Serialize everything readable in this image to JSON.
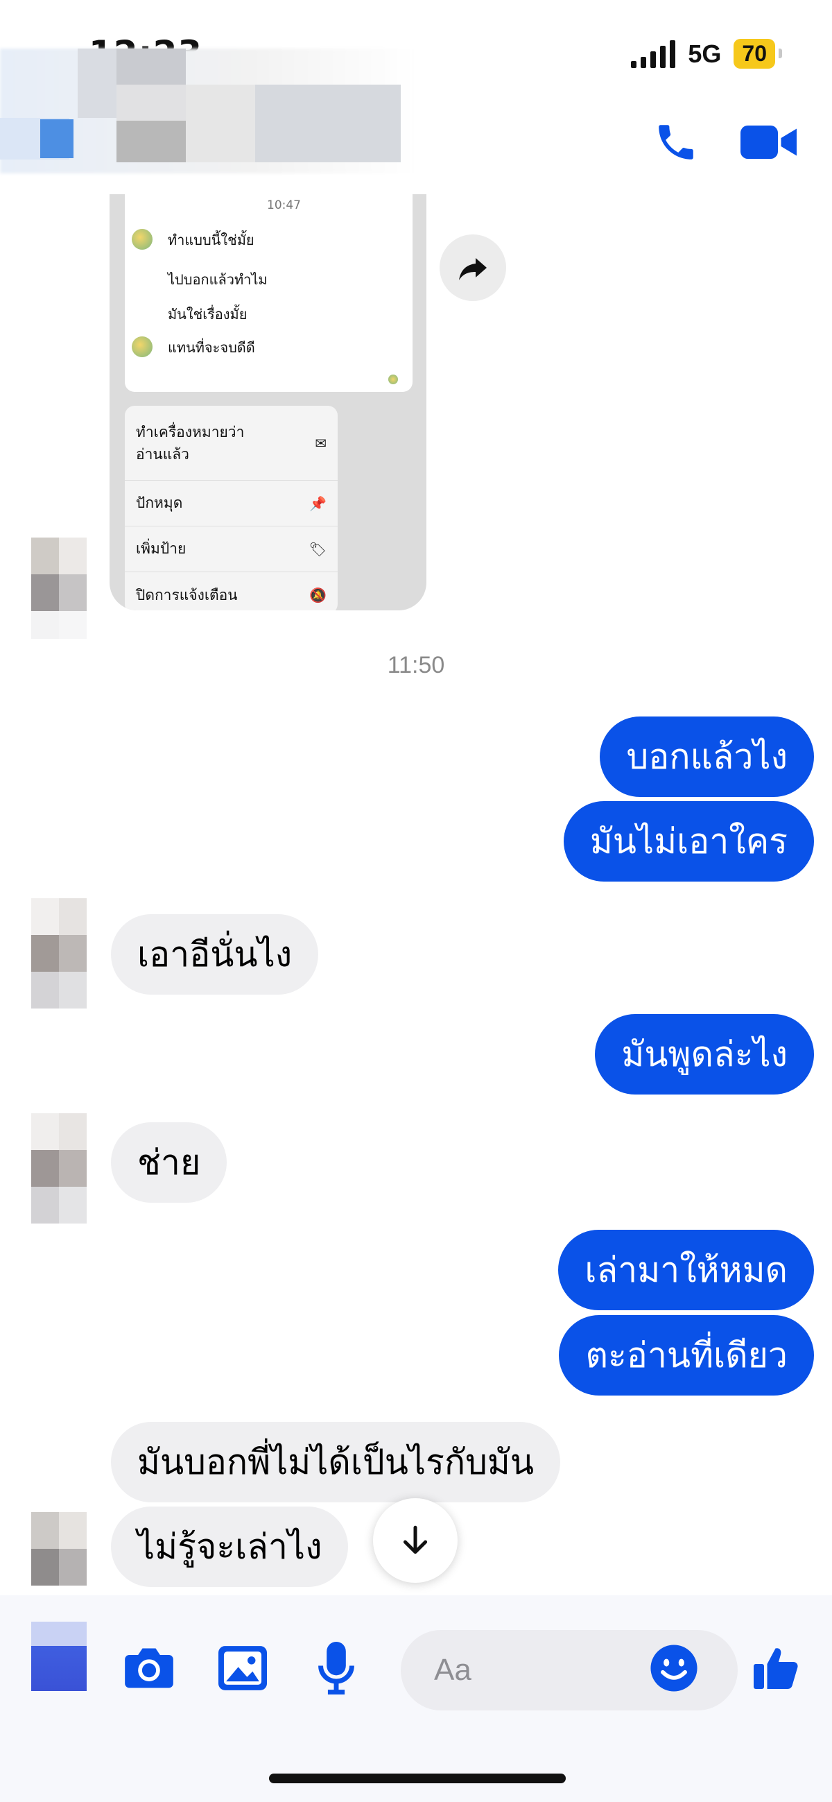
{
  "status_bar": {
    "time": "12:23",
    "network": "5G",
    "battery": "70"
  },
  "header": {
    "contact_name": "",
    "call_icon": "phone-icon",
    "video_icon": "video-camera-icon"
  },
  "forwarded_screenshot": {
    "time": "10:47",
    "messages": [
      "ทำแบบนี้ใช่มั้ย",
      "ไปบอกแล้วทำไม",
      "มันใช่เรื่องมั้ย",
      "แทนที่จะจบดีดี"
    ],
    "menu": [
      {
        "label_line1": "ทำเครื่องหมายว่า",
        "label_line2": "อ่านแล้ว",
        "icon": "mark-read-icon"
      },
      {
        "label_line1": "ปักหมุด",
        "label_line2": "",
        "icon": "pin-icon"
      },
      {
        "label_line1": "เพิ่มป้าย",
        "label_line2": "",
        "icon": "tag-icon"
      },
      {
        "label_line1": "ปิดการแจ้งเตือน",
        "label_line2": "",
        "icon": "mute-icon"
      }
    ]
  },
  "conversation": {
    "timestamp": "11:50",
    "messages": [
      {
        "side": "out",
        "text": "บอกแล้วไง"
      },
      {
        "side": "out",
        "text": "มันไม่เอาใคร"
      },
      {
        "side": "in",
        "text": "เอาอีนั่นไง"
      },
      {
        "side": "out",
        "text": "มันพูดล่ะไง"
      },
      {
        "side": "in",
        "text": "ช่าย"
      },
      {
        "side": "out",
        "text": "เล่ามาให้หมด"
      },
      {
        "side": "out",
        "text": "ตะอ่านที่เดียว"
      },
      {
        "side": "in",
        "text": "มันบอกพี่ไม่ได้เป็นไรกับมัน"
      },
      {
        "side": "in",
        "text": "ไม่รู้จะเล่าไง"
      }
    ]
  },
  "composer": {
    "placeholder": "Aa",
    "icons": [
      "camera-icon",
      "image-icon",
      "microphone-icon",
      "emoji-icon",
      "thumbs-up-icon"
    ]
  },
  "colors": {
    "accent": "#0a52e8",
    "incoming_bubble": "#efeff1",
    "battery": "#f6c81b"
  }
}
